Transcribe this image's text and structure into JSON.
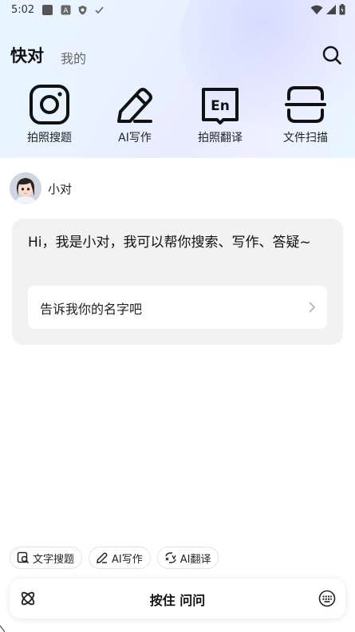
{
  "status_bar": {
    "time": "5:02"
  },
  "header": {
    "tab_active": "快对",
    "tab_inactive": "我的"
  },
  "tools": [
    {
      "label": "拍照搜题",
      "icon": "camera-icon"
    },
    {
      "label": "AI写作",
      "icon": "pen-icon"
    },
    {
      "label": "拍照翻译",
      "icon": "translate-en-icon"
    },
    {
      "label": "文件扫描",
      "icon": "scan-icon"
    }
  ],
  "bot": {
    "name": "小对"
  },
  "message": {
    "greeting": "Hi，我是小对，我可以帮你搜索、写作、答疑~",
    "suggestion": "告诉我你的名字吧"
  },
  "quick_chips": [
    {
      "label": "文字搜题",
      "icon": "text-search-icon"
    },
    {
      "label": "AI写作",
      "icon": "pen-icon"
    },
    {
      "label": "AI翻译",
      "icon": "translate-icon"
    }
  ],
  "input_bar": {
    "hold_to_ask": "按住 问问"
  }
}
